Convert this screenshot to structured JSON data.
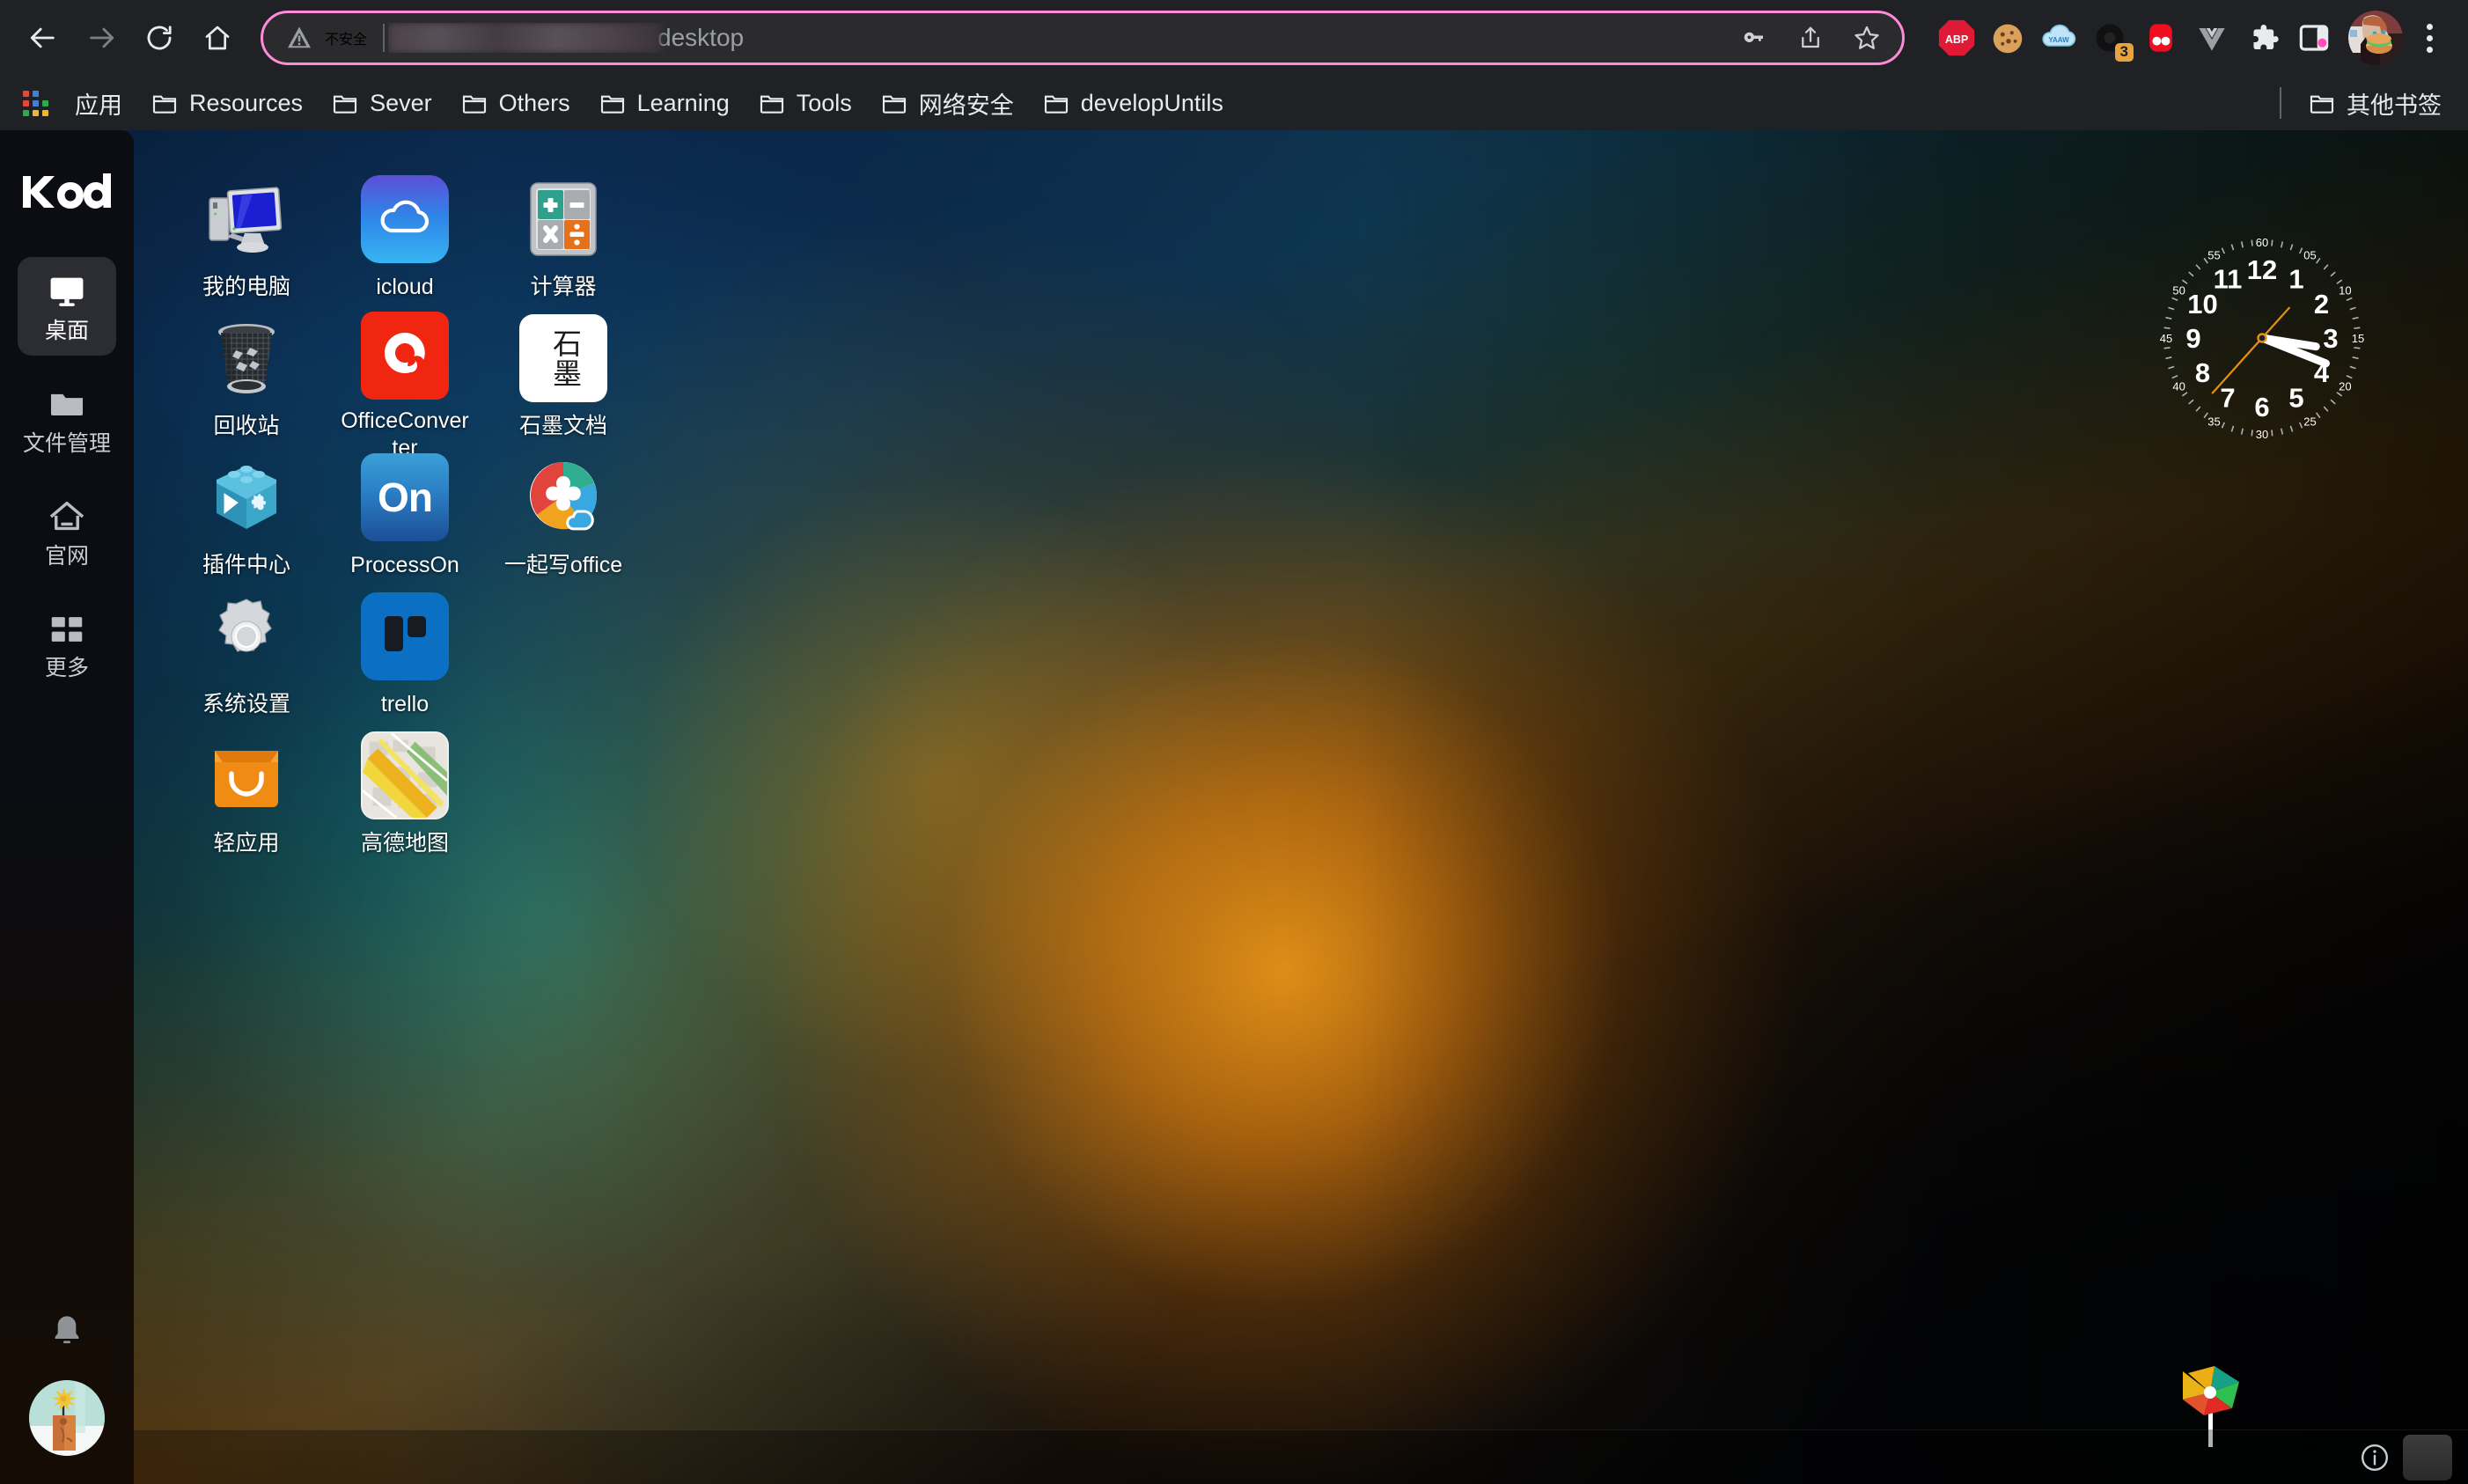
{
  "browser": {
    "nav": {
      "back_label": "Back",
      "forward_label": "Forward",
      "reload_label": "Reload",
      "home_label": "Home"
    },
    "omnibox": {
      "security_label": "不安全",
      "url_visible_text": "desktop",
      "url_redacted": true,
      "highlight_color": "#ff8ad8",
      "key_label": "Save password",
      "share_label": "Share",
      "bookmark_label": "Bookmark this tab"
    },
    "extensions": [
      {
        "name": "adblock-plus-extension",
        "label": "ABP",
        "color": "#e01a36"
      },
      {
        "name": "cookie-extension",
        "label": "Cookie",
        "color": "#d9a15c"
      },
      {
        "name": "yaaw-cloud-extension",
        "label": "YAAW",
        "color": "#6fc4ee"
      },
      {
        "name": "onetab-extension",
        "label": "O",
        "color": "#111111",
        "badge": "3",
        "badge_color": "#e8a33d"
      },
      {
        "name": "pocket-extension",
        "label": "Pocket",
        "color": "#ef0d20"
      },
      {
        "name": "vue-devtools-extension",
        "label": "V",
        "color": "#9aa0a6"
      },
      {
        "name": "extensions-puzzle-icon",
        "label": "Extensions",
        "color": "#e8eaed"
      },
      {
        "name": "side-panel-icon",
        "label": "Side panel",
        "color": "#e8eaed"
      }
    ],
    "profile_label": "Profile",
    "menu_label": "Customize and control"
  },
  "bookmarks": {
    "apps_label": "应用",
    "items": [
      {
        "label": "Resources"
      },
      {
        "label": "Sever"
      },
      {
        "label": "Others"
      },
      {
        "label": "Learning"
      },
      {
        "label": "Tools"
      },
      {
        "label": "网络安全"
      },
      {
        "label": "developUntils"
      }
    ],
    "other_bookmarks_label": "其他书签"
  },
  "dock": {
    "logo_text": "kod",
    "items": [
      {
        "label": "桌面",
        "icon": "monitor-icon",
        "active": true
      },
      {
        "label": "文件管理",
        "icon": "folder-icon",
        "active": false
      },
      {
        "label": "官网",
        "icon": "home-icon",
        "active": false
      },
      {
        "label": "更多",
        "icon": "grid-icon",
        "active": false
      }
    ],
    "notification_label": "通知",
    "avatar_label": "用户头像"
  },
  "desktop": {
    "icons": [
      {
        "label": "我的电脑",
        "icon": "my-computer-icon"
      },
      {
        "label": "icloud",
        "icon": "icloud-icon"
      },
      {
        "label": "计算器",
        "icon": "calculator-icon"
      },
      {
        "label": "回收站",
        "icon": "recycle-bin-icon"
      },
      {
        "label": "OfficeConverter",
        "icon": "officeconverter-icon"
      },
      {
        "label": "石墨文档",
        "icon": "shimo-docs-icon",
        "glyph": "石墨"
      },
      {
        "label": "插件中心",
        "icon": "plugin-center-icon"
      },
      {
        "label": "ProcessOn",
        "icon": "processon-icon",
        "glyph": "On"
      },
      {
        "label": "一起写office",
        "icon": "yiqixie-office-icon"
      },
      {
        "label": "系统设置",
        "icon": "system-settings-icon"
      },
      {
        "label": "trello",
        "icon": "trello-icon"
      },
      {
        "label": "",
        "icon": "empty-slot"
      },
      {
        "label": "轻应用",
        "icon": "light-app-store-icon"
      },
      {
        "label": "高德地图",
        "icon": "amap-icon"
      }
    ]
  },
  "clock": {
    "name": "analog-clock-widget",
    "hours": [
      "12",
      "1",
      "2",
      "3",
      "4",
      "5",
      "6",
      "7",
      "8",
      "9",
      "10",
      "11"
    ],
    "minute_marks": [
      "60",
      "05",
      "10",
      "15",
      "20",
      "25",
      "30",
      "35",
      "40",
      "45",
      "50",
      "55"
    ],
    "time": "3:18:37",
    "hour_value": 3,
    "minute_value": 18,
    "second_value": 37,
    "second_hand_color": "#e8920f",
    "hand_color": "#ffffff"
  },
  "taskbar": {
    "info_label": "信息",
    "show_desktop_label": "显示桌面"
  }
}
